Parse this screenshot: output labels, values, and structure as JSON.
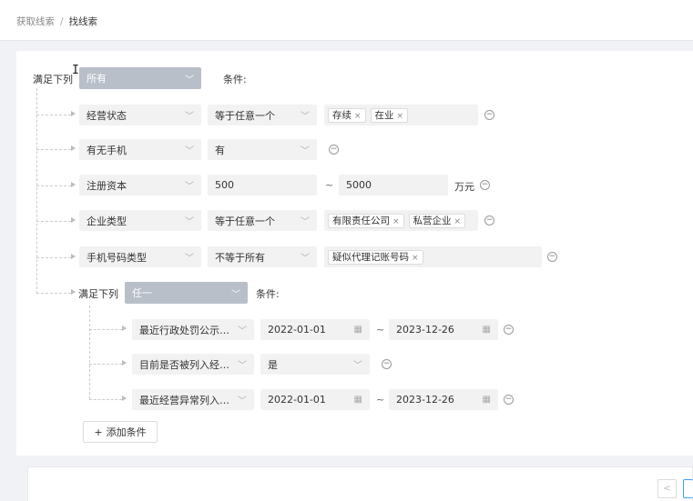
{
  "breadcrumb": {
    "items": [
      "获取线索",
      "找线索"
    ],
    "separator": "/"
  },
  "root": {
    "prefix_label": "满足下列",
    "match_value": "所有",
    "suffix_label": "条件:"
  },
  "conditions": [
    {
      "field": "经营状态",
      "op": "等于任意一个",
      "tags": [
        "存续",
        "在业"
      ]
    },
    {
      "field": "有无手机",
      "op": "有"
    },
    {
      "field": "注册资本",
      "min": "500",
      "separator": "~",
      "max": "5000",
      "unit": "万元"
    },
    {
      "field": "企业类型",
      "op": "等于任意一个",
      "tags": [
        "有限责任公司",
        "私营企业"
      ]
    },
    {
      "field": "手机号码类型",
      "op": "不等于所有",
      "tags": [
        "疑似代理记账号码"
      ]
    }
  ],
  "subgroup": {
    "prefix_label": "满足下列",
    "match_value": "任一",
    "suffix_label": "条件:",
    "conditions": [
      {
        "field": "最近行政处罚公示日期",
        "start": "2022-01-01",
        "separator": "~",
        "end": "2023-12-26"
      },
      {
        "field": "目前是否被列入经营...",
        "op": "是"
      },
      {
        "field": "最近经营异常列入日期",
        "start": "2022-01-01",
        "separator": "~",
        "end": "2023-12-26"
      }
    ]
  },
  "add_condition": {
    "icon": "+",
    "label": "添加条件"
  },
  "pagination": {
    "prev_icon": "<",
    "current": "1"
  },
  "icons": {
    "chevron": "﹀",
    "remove": "−",
    "tag_close": "×",
    "calendar": "▦"
  },
  "colors": {
    "match_select_bg": "#b8bfc9",
    "field_bg": "#f2f2f2",
    "pagination_active": "#409eff"
  }
}
